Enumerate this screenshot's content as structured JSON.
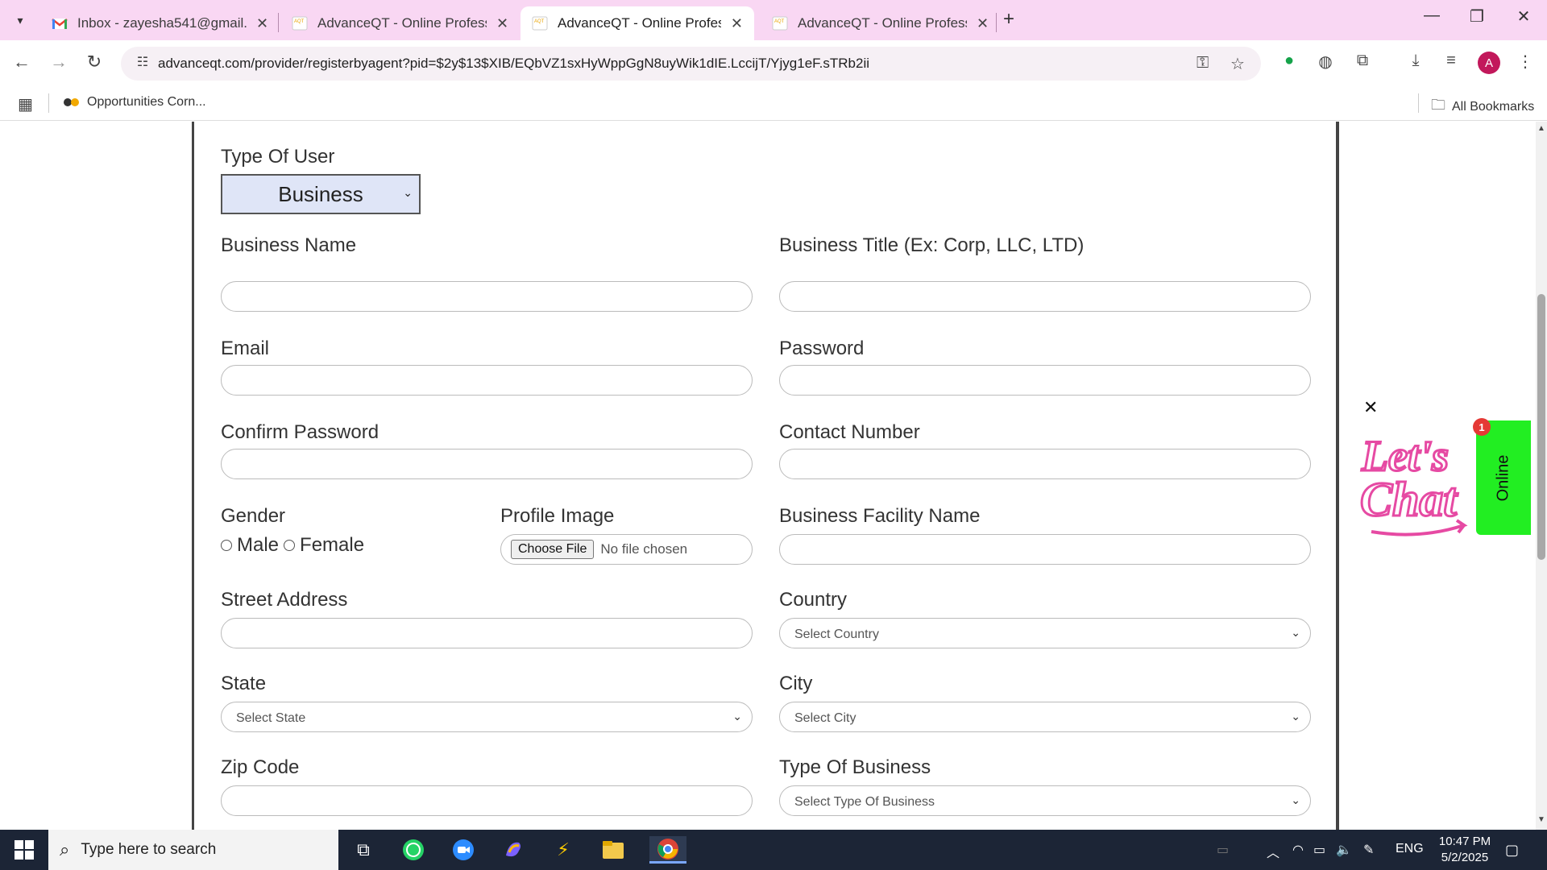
{
  "browser": {
    "tabs": [
      {
        "title": "Inbox - zayesha541@gmail.com",
        "favicon": "gmail-icon",
        "active": false
      },
      {
        "title": "AdvanceQT - Online Professional",
        "favicon": "advanceqt-icon",
        "active": false
      },
      {
        "title": "AdvanceQT - Online Professional",
        "favicon": "advanceqt-icon",
        "active": true
      },
      {
        "title": "AdvanceQT - Online Professional",
        "favicon": "advanceqt-icon",
        "active": false
      }
    ],
    "url": "advanceqt.com/provider/registerbyagent?pid=$2y$13$XIB/EQbVZ1sxHyWppGgN8uyWik1dIE.LccijT/Yjyg1eF.sTRb2ii",
    "profile_initial": "A",
    "bookmarks": {
      "item": "Opportunities Corn...",
      "all": "All Bookmarks"
    }
  },
  "form": {
    "type_of_user_label": "Type Of User",
    "type_of_user_value": "Business",
    "business_name_label": "Business Name",
    "business_title_label": "Business Title (Ex: Corp, LLC, LTD)",
    "email_label": "Email",
    "password_label": "Password",
    "confirm_password_label": "Confirm Password",
    "contact_number_label": "Contact Number",
    "gender_label": "Gender",
    "gender_male": "Male",
    "gender_female": "Female",
    "profile_image_label": "Profile Image",
    "choose_file": "Choose File",
    "no_file": "No file chosen",
    "business_facility_label": "Business Facility Name",
    "street_address_label": "Street Address",
    "country_label": "Country",
    "country_value": "Select Country",
    "state_label": "State",
    "state_value": "Select State",
    "city_label": "City",
    "city_value": "Select City",
    "zip_label": "Zip Code",
    "type_of_business_label": "Type Of Business",
    "type_of_business_value": "Select Type Of Business"
  },
  "chat": {
    "close": "✕",
    "online": "Online",
    "badge": "1",
    "art_line1": "Let's",
    "art_line2": "Chat"
  },
  "taskbar": {
    "search_placeholder": "Type here to search",
    "language": "ENG",
    "time": "10:47 PM",
    "date": "5/2/2025"
  },
  "colors": {
    "tabstrip": "#f9d7f3",
    "chat_green": "#22ee22",
    "chat_pink": "#e64aa3",
    "taskbar": "#1c2536"
  }
}
